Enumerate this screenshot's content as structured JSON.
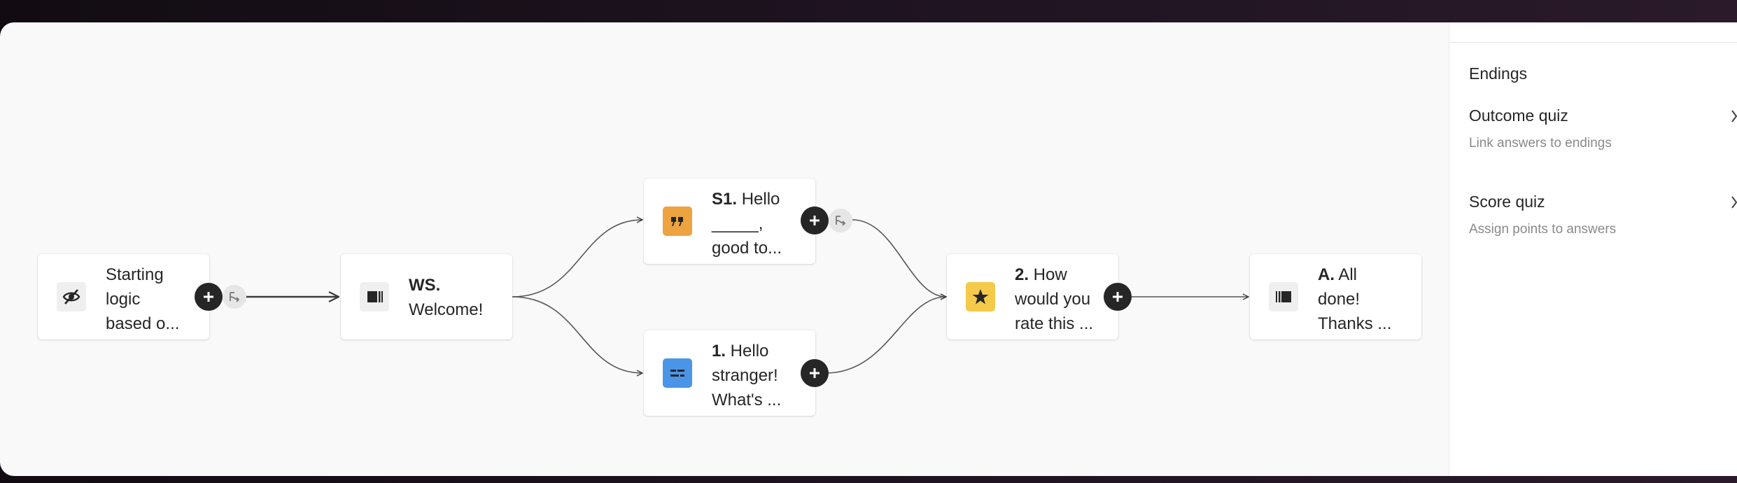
{
  "flow": {
    "nodes": [
      {
        "id": "start",
        "number": "",
        "text_lines": [
          "Starting",
          "logic",
          "based o..."
        ],
        "icon": "eye-off-icon"
      },
      {
        "id": "ws",
        "number": "WS.",
        "text_lines": [
          "",
          "Welcome!"
        ],
        "icon": "welcome-screen-icon"
      },
      {
        "id": "s1",
        "number": "S1.",
        "text_lines": [
          " Hello",
          "_____,",
          "good to..."
        ],
        "icon": "quote-icon"
      },
      {
        "id": "q1",
        "number": "1.",
        "text_lines": [
          " Hello",
          "stranger!",
          "What's ..."
        ],
        "icon": "short-text-icon"
      },
      {
        "id": "q2",
        "number": "2.",
        "text_lines": [
          " How",
          "would you",
          "rate this ..."
        ],
        "icon": "star-icon"
      },
      {
        "id": "ending",
        "number": "A.",
        "text_lines": [
          " All",
          "done!",
          "Thanks ..."
        ],
        "icon": "ending-screen-icon"
      }
    ]
  },
  "sidebar": {
    "section_title": "Endings",
    "items": [
      {
        "title": "Outcome quiz",
        "description": "Link answers to endings",
        "icon": "chevron-right-icon"
      },
      {
        "title": "Score quiz",
        "description": "Assign points to answers",
        "icon": "chevron-right-icon"
      }
    ]
  },
  "colors": {
    "quote": "#eda33f",
    "short_text": "#4b95e8",
    "rating": "#f5c94a",
    "add_button": "#262627"
  }
}
